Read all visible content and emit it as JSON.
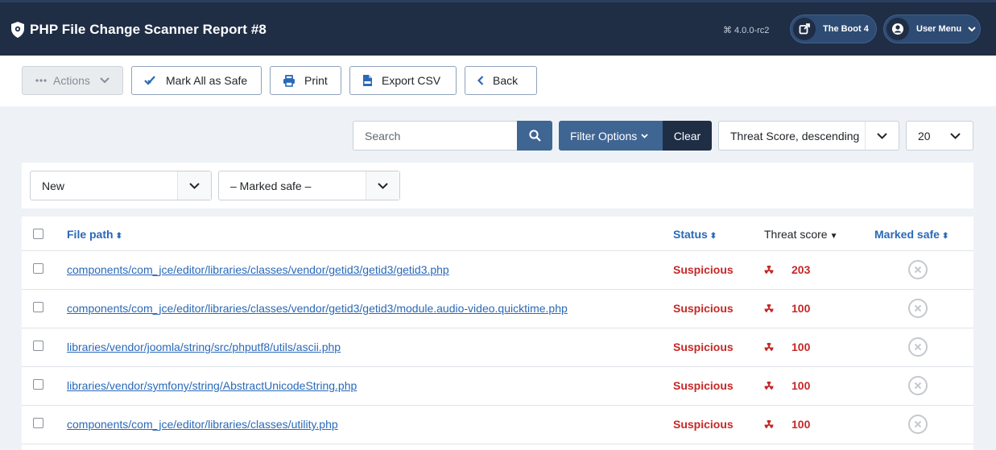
{
  "header": {
    "title": "PHP File Change Scanner Report #8",
    "version": "4.0.0-rc2",
    "site_button": "The Boot 4",
    "user_menu": "User Menu"
  },
  "toolbar": {
    "actions": "Actions",
    "mark_all_safe": "Mark All as Safe",
    "print": "Print",
    "export_csv": "Export CSV",
    "back": "Back"
  },
  "search": {
    "placeholder": "Search",
    "filter_options": "Filter Options",
    "clear": "Clear",
    "sort": "Threat Score, descending",
    "limit": "20"
  },
  "filters": {
    "state": "New",
    "safe": "– Marked safe –"
  },
  "table": {
    "columns": {
      "file_path": "File path",
      "status": "Status",
      "threat_score": "Threat score",
      "marked_safe": "Marked safe"
    },
    "rows": [
      {
        "path": "components/com_jce/editor/libraries/classes/vendor/getid3/getid3/getid3.php",
        "status": "Suspicious",
        "score": "203"
      },
      {
        "path": "components/com_jce/editor/libraries/classes/vendor/getid3/getid3/module.audio-video.quicktime.php",
        "status": "Suspicious",
        "score": "100"
      },
      {
        "path": "libraries/vendor/joomla/string/src/phputf8/utils/ascii.php",
        "status": "Suspicious",
        "score": "100"
      },
      {
        "path": "libraries/vendor/symfony/string/AbstractUnicodeString.php",
        "status": "Suspicious",
        "score": "100"
      },
      {
        "path": "components/com_jce/editor/libraries/classes/utility.php",
        "status": "Suspicious",
        "score": "100"
      }
    ]
  },
  "colors": {
    "header_bg": "#1f2d45",
    "primary": "#3f6593",
    "link": "#2a69b8",
    "danger": "#c52827"
  }
}
